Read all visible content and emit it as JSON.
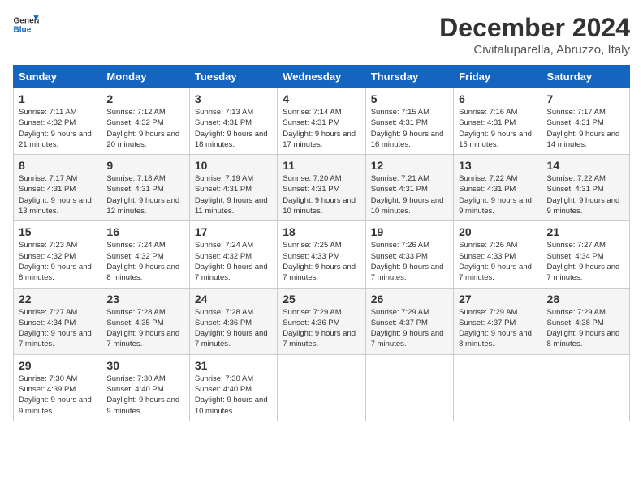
{
  "header": {
    "logo_line1": "General",
    "logo_line2": "Blue",
    "month": "December 2024",
    "location": "Civitaluparella, Abruzzo, Italy"
  },
  "weekdays": [
    "Sunday",
    "Monday",
    "Tuesday",
    "Wednesday",
    "Thursday",
    "Friday",
    "Saturday"
  ],
  "weeks": [
    [
      {
        "day": "1",
        "sunrise": "Sunrise: 7:11 AM",
        "sunset": "Sunset: 4:32 PM",
        "daylight": "Daylight: 9 hours and 21 minutes."
      },
      {
        "day": "2",
        "sunrise": "Sunrise: 7:12 AM",
        "sunset": "Sunset: 4:32 PM",
        "daylight": "Daylight: 9 hours and 20 minutes."
      },
      {
        "day": "3",
        "sunrise": "Sunrise: 7:13 AM",
        "sunset": "Sunset: 4:31 PM",
        "daylight": "Daylight: 9 hours and 18 minutes."
      },
      {
        "day": "4",
        "sunrise": "Sunrise: 7:14 AM",
        "sunset": "Sunset: 4:31 PM",
        "daylight": "Daylight: 9 hours and 17 minutes."
      },
      {
        "day": "5",
        "sunrise": "Sunrise: 7:15 AM",
        "sunset": "Sunset: 4:31 PM",
        "daylight": "Daylight: 9 hours and 16 minutes."
      },
      {
        "day": "6",
        "sunrise": "Sunrise: 7:16 AM",
        "sunset": "Sunset: 4:31 PM",
        "daylight": "Daylight: 9 hours and 15 minutes."
      },
      {
        "day": "7",
        "sunrise": "Sunrise: 7:17 AM",
        "sunset": "Sunset: 4:31 PM",
        "daylight": "Daylight: 9 hours and 14 minutes."
      }
    ],
    [
      {
        "day": "8",
        "sunrise": "Sunrise: 7:17 AM",
        "sunset": "Sunset: 4:31 PM",
        "daylight": "Daylight: 9 hours and 13 minutes."
      },
      {
        "day": "9",
        "sunrise": "Sunrise: 7:18 AM",
        "sunset": "Sunset: 4:31 PM",
        "daylight": "Daylight: 9 hours and 12 minutes."
      },
      {
        "day": "10",
        "sunrise": "Sunrise: 7:19 AM",
        "sunset": "Sunset: 4:31 PM",
        "daylight": "Daylight: 9 hours and 11 minutes."
      },
      {
        "day": "11",
        "sunrise": "Sunrise: 7:20 AM",
        "sunset": "Sunset: 4:31 PM",
        "daylight": "Daylight: 9 hours and 10 minutes."
      },
      {
        "day": "12",
        "sunrise": "Sunrise: 7:21 AM",
        "sunset": "Sunset: 4:31 PM",
        "daylight": "Daylight: 9 hours and 10 minutes."
      },
      {
        "day": "13",
        "sunrise": "Sunrise: 7:22 AM",
        "sunset": "Sunset: 4:31 PM",
        "daylight": "Daylight: 9 hours and 9 minutes."
      },
      {
        "day": "14",
        "sunrise": "Sunrise: 7:22 AM",
        "sunset": "Sunset: 4:31 PM",
        "daylight": "Daylight: 9 hours and 9 minutes."
      }
    ],
    [
      {
        "day": "15",
        "sunrise": "Sunrise: 7:23 AM",
        "sunset": "Sunset: 4:32 PM",
        "daylight": "Daylight: 9 hours and 8 minutes."
      },
      {
        "day": "16",
        "sunrise": "Sunrise: 7:24 AM",
        "sunset": "Sunset: 4:32 PM",
        "daylight": "Daylight: 9 hours and 8 minutes."
      },
      {
        "day": "17",
        "sunrise": "Sunrise: 7:24 AM",
        "sunset": "Sunset: 4:32 PM",
        "daylight": "Daylight: 9 hours and 7 minutes."
      },
      {
        "day": "18",
        "sunrise": "Sunrise: 7:25 AM",
        "sunset": "Sunset: 4:33 PM",
        "daylight": "Daylight: 9 hours and 7 minutes."
      },
      {
        "day": "19",
        "sunrise": "Sunrise: 7:26 AM",
        "sunset": "Sunset: 4:33 PM",
        "daylight": "Daylight: 9 hours and 7 minutes."
      },
      {
        "day": "20",
        "sunrise": "Sunrise: 7:26 AM",
        "sunset": "Sunset: 4:33 PM",
        "daylight": "Daylight: 9 hours and 7 minutes."
      },
      {
        "day": "21",
        "sunrise": "Sunrise: 7:27 AM",
        "sunset": "Sunset: 4:34 PM",
        "daylight": "Daylight: 9 hours and 7 minutes."
      }
    ],
    [
      {
        "day": "22",
        "sunrise": "Sunrise: 7:27 AM",
        "sunset": "Sunset: 4:34 PM",
        "daylight": "Daylight: 9 hours and 7 minutes."
      },
      {
        "day": "23",
        "sunrise": "Sunrise: 7:28 AM",
        "sunset": "Sunset: 4:35 PM",
        "daylight": "Daylight: 9 hours and 7 minutes."
      },
      {
        "day": "24",
        "sunrise": "Sunrise: 7:28 AM",
        "sunset": "Sunset: 4:36 PM",
        "daylight": "Daylight: 9 hours and 7 minutes."
      },
      {
        "day": "25",
        "sunrise": "Sunrise: 7:29 AM",
        "sunset": "Sunset: 4:36 PM",
        "daylight": "Daylight: 9 hours and 7 minutes."
      },
      {
        "day": "26",
        "sunrise": "Sunrise: 7:29 AM",
        "sunset": "Sunset: 4:37 PM",
        "daylight": "Daylight: 9 hours and 7 minutes."
      },
      {
        "day": "27",
        "sunrise": "Sunrise: 7:29 AM",
        "sunset": "Sunset: 4:37 PM",
        "daylight": "Daylight: 9 hours and 8 minutes."
      },
      {
        "day": "28",
        "sunrise": "Sunrise: 7:29 AM",
        "sunset": "Sunset: 4:38 PM",
        "daylight": "Daylight: 9 hours and 8 minutes."
      }
    ],
    [
      {
        "day": "29",
        "sunrise": "Sunrise: 7:30 AM",
        "sunset": "Sunset: 4:39 PM",
        "daylight": "Daylight: 9 hours and 9 minutes."
      },
      {
        "day": "30",
        "sunrise": "Sunrise: 7:30 AM",
        "sunset": "Sunset: 4:40 PM",
        "daylight": "Daylight: 9 hours and 9 minutes."
      },
      {
        "day": "31",
        "sunrise": "Sunrise: 7:30 AM",
        "sunset": "Sunset: 4:40 PM",
        "daylight": "Daylight: 9 hours and 10 minutes."
      },
      null,
      null,
      null,
      null
    ]
  ]
}
